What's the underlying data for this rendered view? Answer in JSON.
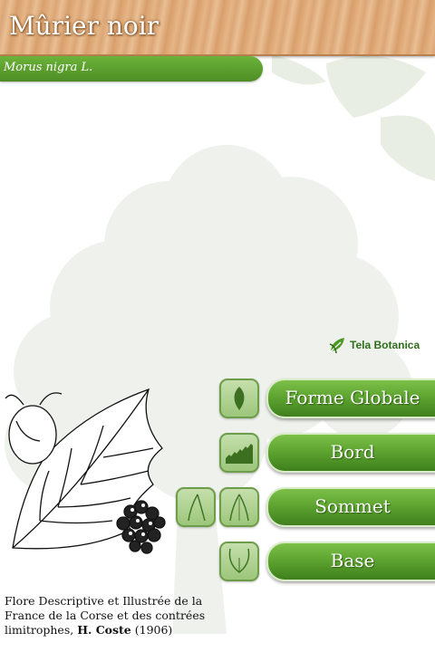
{
  "header": {
    "title": "Mûrier noir"
  },
  "latin_name": "Morus nigra L.",
  "logo": {
    "text": "Tela Botanica",
    "icon": "leaf-logo-icon"
  },
  "buttons": [
    {
      "label": "Forme Globale",
      "icon": "leaf-shape-icon"
    },
    {
      "label": "Bord",
      "icon": "serrated-edge-icon"
    },
    {
      "label": "Sommet",
      "icon": "leaf-tip-icon",
      "alt_icon": "acute-tip-icon"
    },
    {
      "label": "Base",
      "icon": "leaf-base-icon"
    }
  ],
  "caption": {
    "text": "Flore Descriptive et Illustrée de la France de la Corse et des contrées limitrophes, ",
    "author": "H. Coste",
    "year": " (1906)"
  },
  "colors": {
    "accent_green": "#5ea531",
    "wood": "#e2b07e"
  }
}
